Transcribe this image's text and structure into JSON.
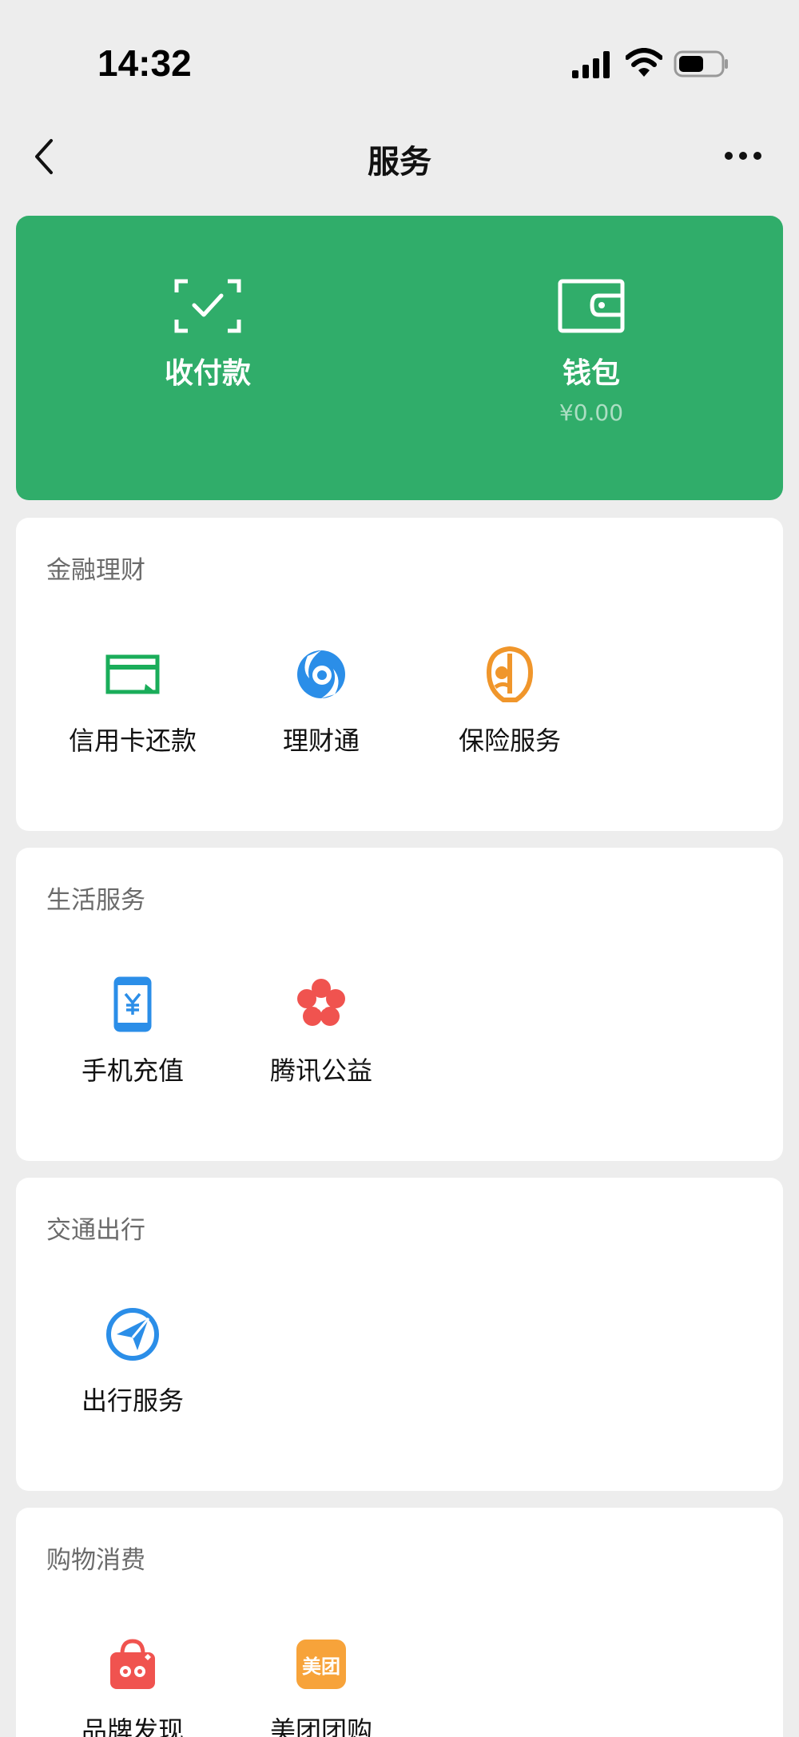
{
  "status": {
    "time": "14:32"
  },
  "nav": {
    "title": "服务"
  },
  "pay_card": {
    "receive_label": "收付款",
    "wallet_label": "钱包",
    "wallet_balance": "¥0.00",
    "background": "#30ad6a"
  },
  "sections": [
    {
      "title": "金融理财",
      "items": [
        {
          "label": "信用卡还款",
          "icon": "credit-card-icon",
          "color": "#1aad5a"
        },
        {
          "label": "理财通",
          "icon": "wealth-icon",
          "color": "#2b8ee8"
        },
        {
          "label": "保险服务",
          "icon": "insurance-icon",
          "color": "#f0962b"
        }
      ]
    },
    {
      "title": "生活服务",
      "items": [
        {
          "label": "手机充值",
          "icon": "phone-topup-icon",
          "color": "#2b8ee8"
        },
        {
          "label": "腾讯公益",
          "icon": "charity-flower-icon",
          "color": "#f0534f"
        }
      ]
    },
    {
      "title": "交通出行",
      "items": [
        {
          "label": "出行服务",
          "icon": "navigation-arrow-icon",
          "color": "#2b8ee8"
        }
      ]
    },
    {
      "title": "购物消费",
      "items": [
        {
          "label": "品牌发现",
          "icon": "shopping-bag-icon",
          "color": "#f0534f"
        },
        {
          "label": "美团团购",
          "icon": "meituan-icon",
          "icon_text": "美团",
          "color": "#f7a33a"
        }
      ]
    }
  ]
}
